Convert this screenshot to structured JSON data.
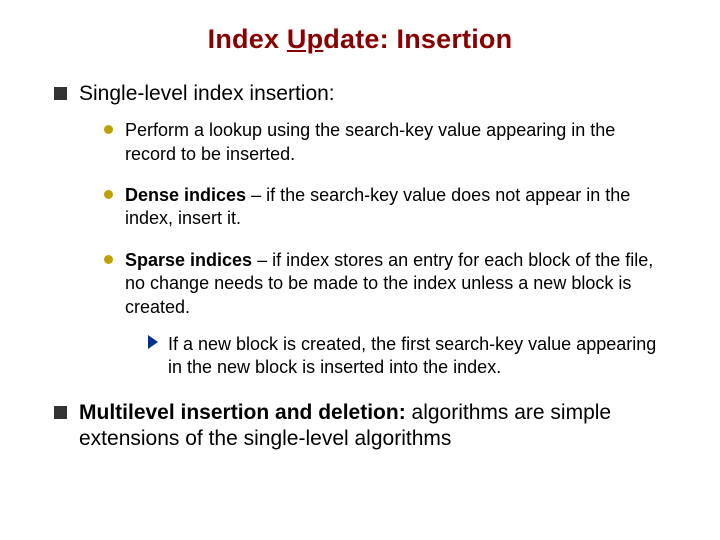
{
  "title": {
    "pre": "Index ",
    "underlined": "Up",
    "post": "date:  Insertion",
    "color": "#880000"
  },
  "level1_a": "Single-level index insertion:",
  "l2a": "Perform a lookup using the search-key value appearing in the record to be inserted.",
  "l2b_bold": "Dense indices",
  "l2b_rest": " – if the search-key value does not appear in the index, insert it.",
  "l2c_bold": "Sparse indices",
  "l2c_rest": " – if index stores an entry for each block of the file, no change needs to be made to the index unless a new block is created.",
  "l3": "If a new block is created, the first search-key value appearing in the new block is inserted into the index.",
  "level1_b_bold": "Multilevel insertion and deletion:",
  "level1_b_rest": "  algorithms are simple extensions of the single-level algorithms"
}
